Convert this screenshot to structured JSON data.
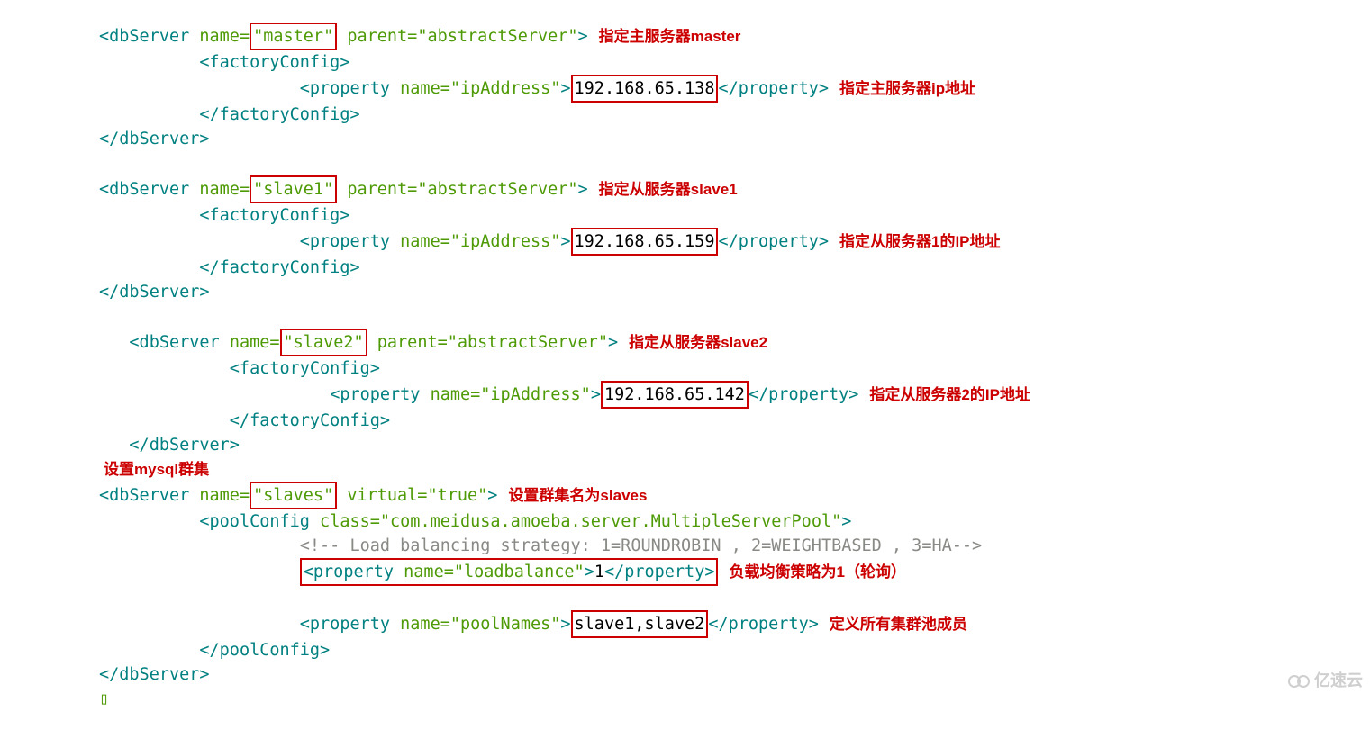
{
  "blocks": {
    "master": {
      "name": "master",
      "parent": "abstractServer",
      "ip": "192.168.65.138",
      "annName": "指定主服务器master",
      "annIp": "指定主服务器ip地址"
    },
    "slave1": {
      "name": "slave1",
      "parent": "abstractServer",
      "ip": "192.168.65.159",
      "annName": "指定从服务器slave1",
      "annIp": "指定从服务器1的IP地址"
    },
    "slave2": {
      "name": "slave2",
      "parent": "abstractServer",
      "ip": "192.168.65.142",
      "annName": "指定从服务器slave2",
      "annIp": "指定从服务器2的IP地址"
    },
    "slaves": {
      "name": "slaves",
      "virtual": "true",
      "poolClass": "com.meidusa.amoeba.server.MultipleServerPool",
      "loadbalance": "1",
      "poolNames": "slave1,slave2",
      "annCluster": "设置mysql群集",
      "annName": "设置群集名为slaves",
      "annLb": "负载均衡策略为1（轮询）",
      "annPool": "定义所有集群池成员",
      "comment": "<!-- Load balancing strategy: 1=ROUNDROBIN , 2=WEIGHTBASED , 3=HA-->"
    }
  },
  "tags": {
    "dbServerOpen": "<dbServer",
    "dbServerClose": "</dbServer>",
    "factoryOpen": "<factoryConfig>",
    "factoryClose": "</factoryConfig>",
    "propOpen": "<property",
    "propClose": "</property>",
    "poolOpen": "<poolConfig",
    "poolClose": "</poolConfig>",
    "nameAttr": "name=",
    "parentAttr": " parent=",
    "virtualAttr": " virtual=",
    "classAttr": " class=",
    "close": ">",
    "quote": "\"",
    "ipAddr": "ipAddress",
    "lb": "loadbalance",
    "pn": "poolNames",
    "true": "true"
  },
  "watermark": "亿速云"
}
